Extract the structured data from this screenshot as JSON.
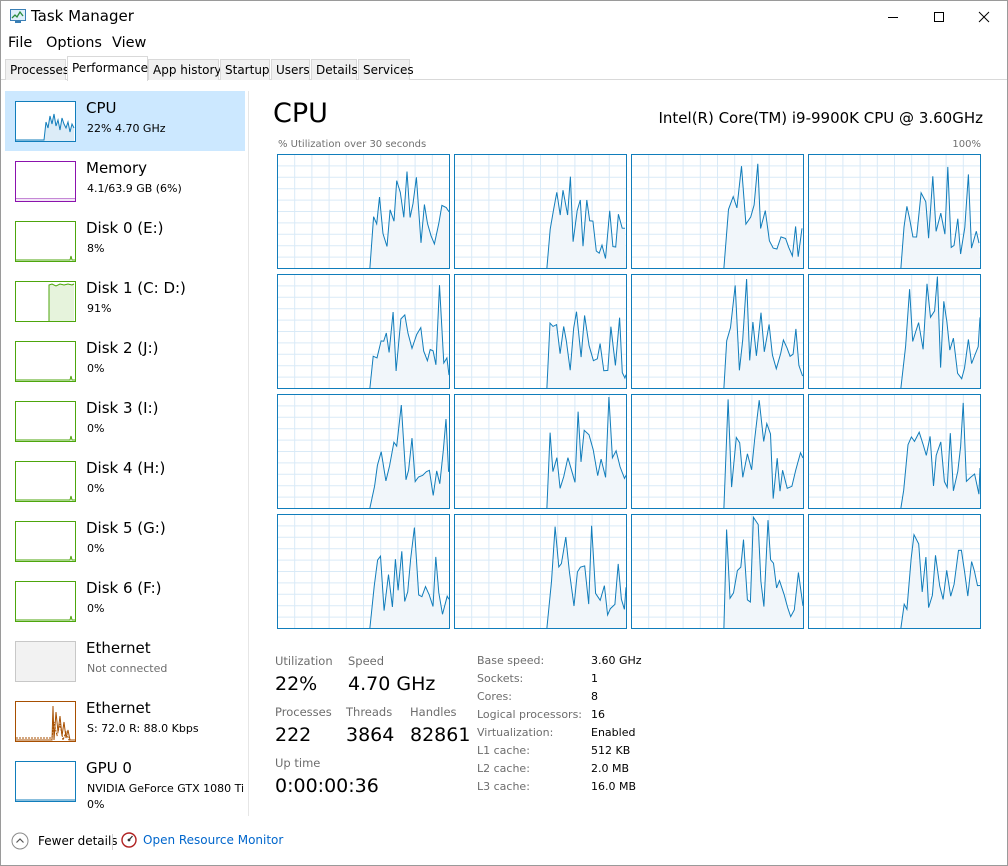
{
  "window": {
    "title": "Task Manager"
  },
  "menu": [
    "File",
    "Options",
    "View"
  ],
  "tabs": [
    "Processes",
    "Performance",
    "App history",
    "Startup",
    "Users",
    "Details",
    "Services"
  ],
  "active_tab": "Performance",
  "sidebar": [
    {
      "title": "CPU",
      "sub": "22%  4.70 GHz",
      "color": "#117dbb",
      "selected": true,
      "icon": "cpu-sparkline"
    },
    {
      "title": "Memory",
      "sub": "4.1/63.9 GB (6%)",
      "color": "#8b12ae",
      "icon": "memory-sparkline"
    },
    {
      "title": "Disk 0 (E:)",
      "sub": "8%",
      "color": "#4da60c",
      "icon": "disk-sparkline"
    },
    {
      "title": "Disk 1 (C: D:)",
      "sub": "91%",
      "color": "#4da60c",
      "icon": "disk-sparkline"
    },
    {
      "title": "Disk 2 (J:)",
      "sub": "0%",
      "color": "#4da60c",
      "icon": "disk-sparkline"
    },
    {
      "title": "Disk 3 (I:)",
      "sub": "0%",
      "color": "#4da60c",
      "icon": "disk-sparkline"
    },
    {
      "title": "Disk 4 (H:)",
      "sub": "0%",
      "color": "#4da60c",
      "icon": "disk-sparkline"
    },
    {
      "title": "Disk 5 (G:)",
      "sub": "0%",
      "color": "#4da60c",
      "icon": "disk-sparkline"
    },
    {
      "title": "Disk 6 (F:)",
      "sub": "0%",
      "color": "#4da60c",
      "icon": "disk-sparkline"
    },
    {
      "title": "Ethernet",
      "sub": "Not connected",
      "color": "#c8c8c8",
      "icon": "ethernet-disabled"
    },
    {
      "title": "Ethernet",
      "sub": "S: 72.0  R: 88.0 Kbps",
      "color": "#a74f01",
      "icon": "ethernet-sparkline"
    },
    {
      "title": "GPU 0",
      "sub": "NVIDIA GeForce GTX 1080 Ti",
      "sub2": "0%",
      "color": "#117dbb",
      "icon": "gpu-sparkline"
    }
  ],
  "cpu": {
    "title": "CPU",
    "model": "Intel(R) Core(TM) i9-9900K CPU @ 3.60GHz",
    "graph_label": "% Utilization over 30 seconds",
    "graph_max": "100%",
    "graph_color": "#117dbb",
    "graph_fill": "#f1f6fa",
    "logical_graph_count": 16,
    "stats": {
      "utilization_label": "Utilization",
      "utilization": "22%",
      "speed_label": "Speed",
      "speed": "4.70 GHz",
      "processes_label": "Processes",
      "processes": "222",
      "threads_label": "Threads",
      "threads": "3864",
      "handles_label": "Handles",
      "handles": "82861",
      "uptime_label": "Up time",
      "uptime": "0:00:00:36"
    },
    "specs": [
      {
        "label": "Base speed:",
        "value": "3.60 GHz"
      },
      {
        "label": "Sockets:",
        "value": "1"
      },
      {
        "label": "Cores:",
        "value": "8"
      },
      {
        "label": "Logical processors:",
        "value": "16"
      },
      {
        "label": "Virtualization:",
        "value": "Enabled"
      },
      {
        "label": "L1 cache:",
        "value": "512 KB"
      },
      {
        "label": "L2 cache:",
        "value": "2.0 MB"
      },
      {
        "label": "L3 cache:",
        "value": "16.0 MB"
      }
    ]
  },
  "footer": {
    "fewer_details": "Fewer details",
    "open_resource_monitor": "Open Resource Monitor"
  }
}
